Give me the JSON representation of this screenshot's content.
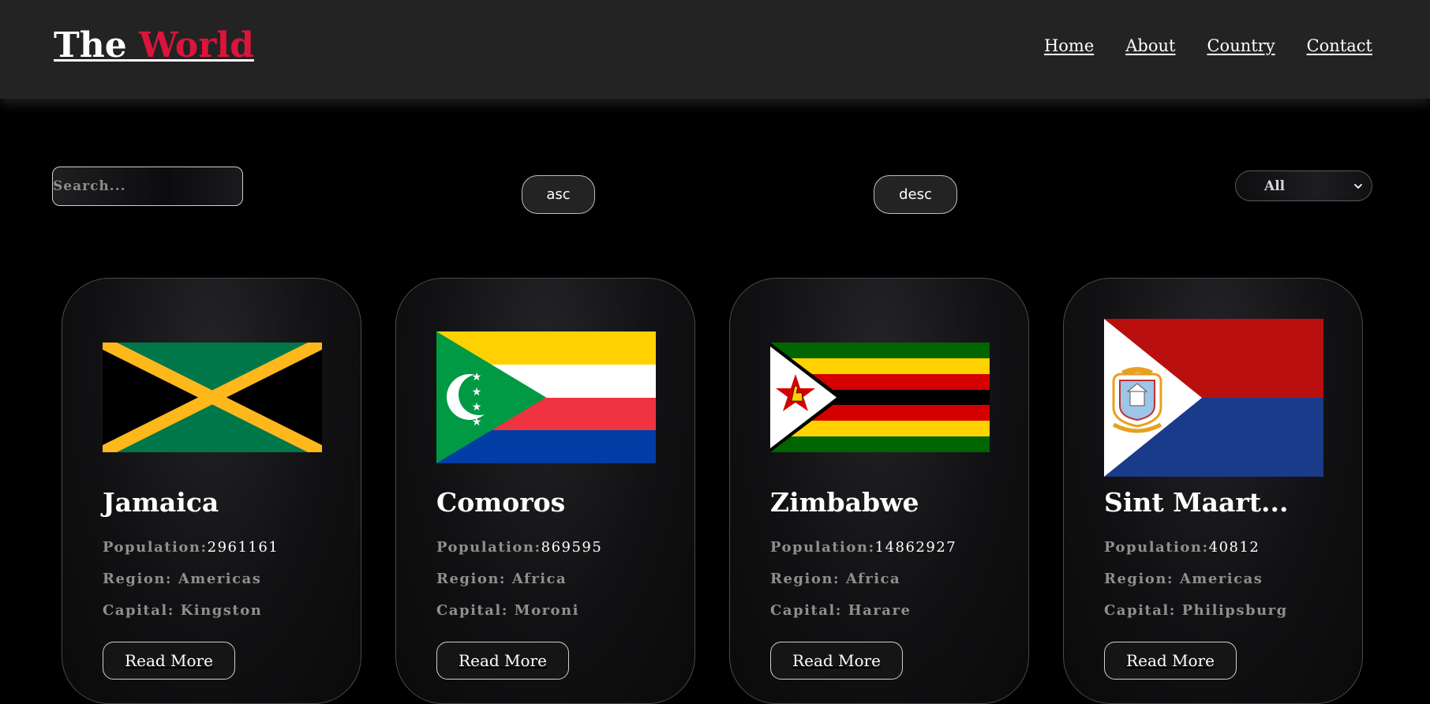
{
  "header": {
    "brand_word1": "The",
    "brand_word2": "World",
    "nav": [
      "Home",
      "About",
      "Country",
      "Contact"
    ]
  },
  "controls": {
    "search_placeholder": "Search...",
    "asc_label": "asc",
    "desc_label": "desc",
    "region_selected": "All"
  },
  "cards": [
    {
      "name": "Jamaica",
      "population_label": "Population:",
      "population": "2961161",
      "region": "Region: Americas",
      "capital": "Capital: Kingston",
      "flag_icon": "jamaica-flag-icon",
      "button": "Read More"
    },
    {
      "name": "Comoros",
      "population_label": "Population:",
      "population": "869595",
      "region": "Region: Africa",
      "capital": "Capital: Moroni",
      "flag_icon": "comoros-flag-icon",
      "button": "Read More"
    },
    {
      "name": "Zimbabwe",
      "population_label": "Population:",
      "population": "14862927",
      "region": "Region: Africa",
      "capital": "Capital: Harare",
      "flag_icon": "zimbabwe-flag-icon",
      "button": "Read More"
    },
    {
      "name": "Sint Maart...",
      "population_label": "Population:",
      "population": "40812",
      "region": "Region: Americas",
      "capital": "Capital: Philipsburg",
      "flag_icon": "sint-maarten-flag-icon",
      "button": "Read More"
    }
  ],
  "colors": {
    "accent": "#dc143c",
    "header_bg": "#232323",
    "page_bg": "#000000"
  }
}
